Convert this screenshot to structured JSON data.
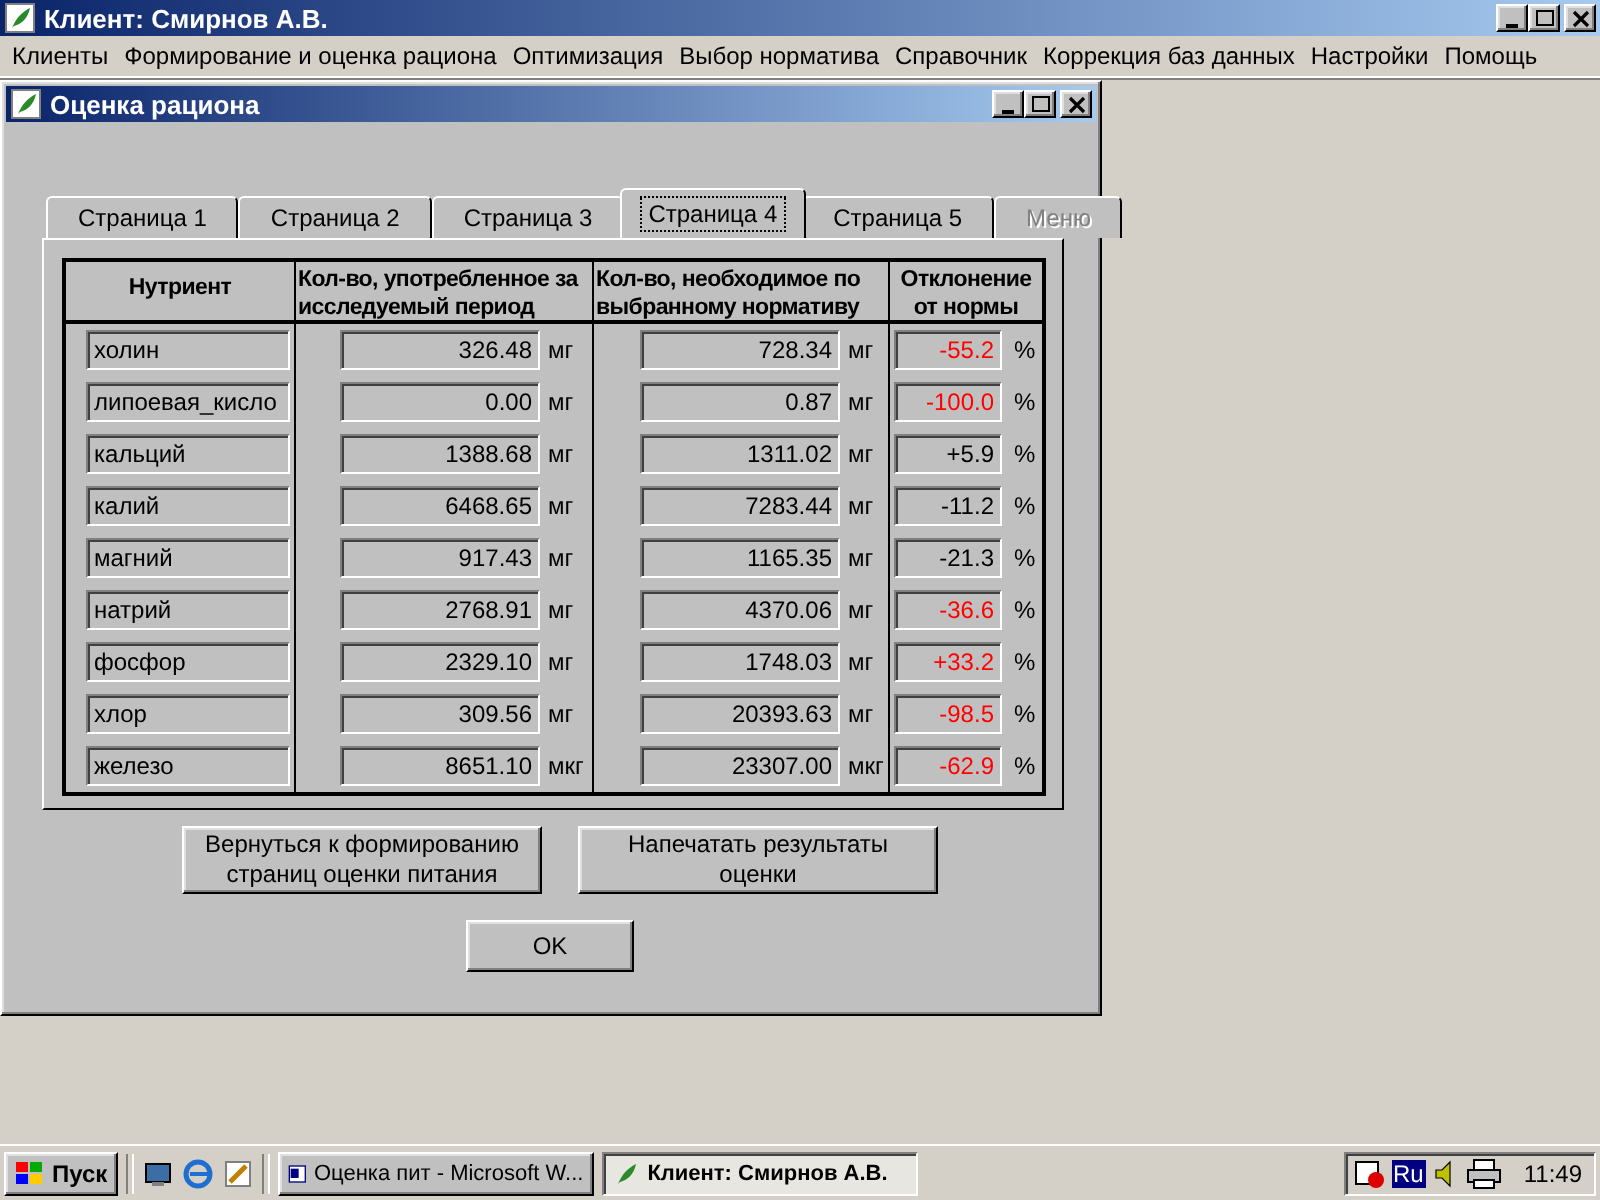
{
  "window": {
    "title": "Клиент: Смирнов А.В."
  },
  "menu": [
    "Клиенты",
    "Формирование и оценка рациона",
    "Оптимизация",
    "Выбор норматива",
    "Справочник",
    "Коррекция  баз данных",
    "Настройки",
    "Помощь"
  ],
  "dialog": {
    "title": "Оценка рациона"
  },
  "tabs": [
    {
      "label": "Страница 1",
      "selected": false,
      "disabled": false
    },
    {
      "label": "Страница 2",
      "selected": false,
      "disabled": false
    },
    {
      "label": "Страница 3",
      "selected": false,
      "disabled": false
    },
    {
      "label": "Страница 4",
      "selected": true,
      "disabled": false
    },
    {
      "label": "Страница 5",
      "selected": false,
      "disabled": false
    },
    {
      "label": "Меню",
      "selected": false,
      "disabled": true
    }
  ],
  "table": {
    "columns": [
      "Нутриент",
      "Кол-во, употребленное за исследуемый период",
      "Кол-во,  необходимое по выбранному нормативу",
      "Отклонение от нормы"
    ],
    "rows": [
      {
        "nutrient": "холин",
        "consumed": "326.48",
        "consumed_unit": "мг",
        "required": "728.34",
        "required_unit": "мг",
        "deviation": "-55.2",
        "alert": true,
        "percent": "%"
      },
      {
        "nutrient": "липоевая_кисло",
        "consumed": "0.00",
        "consumed_unit": "мг",
        "required": "0.87",
        "required_unit": "мг",
        "deviation": "-100.0",
        "alert": true,
        "percent": "%"
      },
      {
        "nutrient": "кальций",
        "consumed": "1388.68",
        "consumed_unit": "мг",
        "required": "1311.02",
        "required_unit": "мг",
        "deviation": "+5.9",
        "alert": false,
        "percent": "%"
      },
      {
        "nutrient": "калий",
        "consumed": "6468.65",
        "consumed_unit": "мг",
        "required": "7283.44",
        "required_unit": "мг",
        "deviation": "-11.2",
        "alert": false,
        "percent": "%"
      },
      {
        "nutrient": "магний",
        "consumed": "917.43",
        "consumed_unit": "мг",
        "required": "1165.35",
        "required_unit": "мг",
        "deviation": "-21.3",
        "alert": false,
        "percent": "%"
      },
      {
        "nutrient": "натрий",
        "consumed": "2768.91",
        "consumed_unit": "мг",
        "required": "4370.06",
        "required_unit": "мг",
        "deviation": "-36.6",
        "alert": true,
        "percent": "%"
      },
      {
        "nutrient": "фосфор",
        "consumed": "2329.10",
        "consumed_unit": "мг",
        "required": "1748.03",
        "required_unit": "мг",
        "deviation": "+33.2",
        "alert": true,
        "percent": "%"
      },
      {
        "nutrient": "хлор",
        "consumed": "309.56",
        "consumed_unit": "мг",
        "required": "20393.63",
        "required_unit": "мг",
        "deviation": "-98.5",
        "alert": true,
        "percent": "%"
      },
      {
        "nutrient": "железо",
        "consumed": "8651.10",
        "consumed_unit": "мкг",
        "required": "23307.00",
        "required_unit": "мкг",
        "deviation": "-62.9",
        "alert": true,
        "percent": "%"
      }
    ]
  },
  "buttons": [
    "Вернуться к формированию страниц оценки питания",
    "Напечатать результаты оценки"
  ],
  "ok_button": "OK",
  "taskbar": {
    "start": "Пуск",
    "tasks": [
      {
        "label": "Оценка пит - Microsoft W...",
        "selected": false,
        "kind": "word"
      },
      {
        "label": "Клиент: Смирнов А.В.",
        "selected": true,
        "kind": "app"
      }
    ],
    "language": "Ru",
    "time": "11:49"
  }
}
